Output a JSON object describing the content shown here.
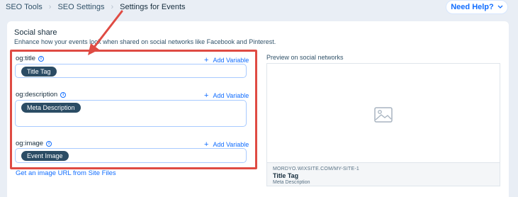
{
  "breadcrumbs": [
    "SEO Tools",
    "SEO Settings",
    "Settings for Events"
  ],
  "help_button": {
    "label": "Need Help?",
    "chevron": "chevron-down-icon"
  },
  "section": {
    "title": "Social share",
    "subtitle": "Enhance how your events look when shared on social networks like Facebook and Pinterest."
  },
  "fields": [
    {
      "label": "og:title",
      "add_variable": "Add Variable",
      "chip": "Title Tag"
    },
    {
      "label": "og:description",
      "add_variable": "Add Variable",
      "chip": "Meta Description"
    },
    {
      "label": "og:image",
      "add_variable": "Add Variable",
      "chip": "Event Image"
    }
  ],
  "image_link": "Get an image URL from Site Files",
  "preview": {
    "label": "Preview on social networks",
    "url": "MORDYO.WIXSITE.COM/MY-SITE-1",
    "title": "Title Tag",
    "description": "Meta Description"
  },
  "colors": {
    "accent": "#116dff",
    "highlight": "#df4b43",
    "chip": "#2b4c64",
    "background": "#e9eef5"
  }
}
